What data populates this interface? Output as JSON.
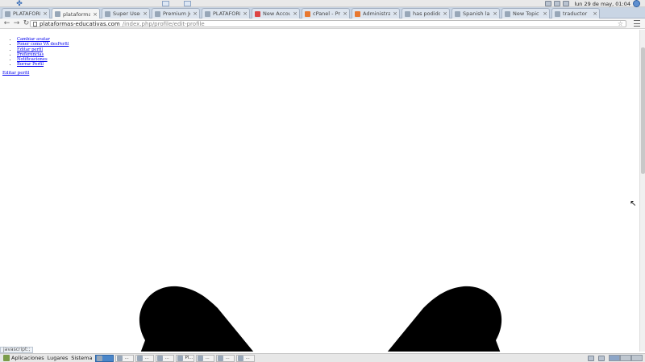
{
  "system": {
    "clock": "lun 29 de may, 01:04"
  },
  "browser": {
    "tabs": [
      {
        "label": "PLATAFORMA",
        "active": false,
        "icon": "globe-icon"
      },
      {
        "label": "plataformas",
        "active": true,
        "icon": "page-icon"
      },
      {
        "label": "Super User",
        "active": false,
        "icon": "site-icon"
      },
      {
        "label": "Premium Joo",
        "active": false,
        "icon": "joomla-icon"
      },
      {
        "label": "PLATAFORM",
        "active": false,
        "icon": "page-icon"
      },
      {
        "label": "New Accoun",
        "active": false,
        "icon": "gmail-icon"
      },
      {
        "label": "cPanel - Prin",
        "active": false,
        "icon": "cpanel-icon"
      },
      {
        "label": "Administrac",
        "active": false,
        "icon": "cpanel-icon"
      },
      {
        "label": "has podido",
        "active": false,
        "icon": "page-icon"
      },
      {
        "label": "Spanish lang",
        "active": false,
        "icon": "page-icon"
      },
      {
        "label": "New Topic",
        "active": false,
        "icon": "page-icon"
      },
      {
        "label": "traductor",
        "active": false,
        "icon": "google-icon"
      }
    ],
    "address": {
      "host": "plataformas-educativas.com",
      "path": "/index.php/profile/edit-profile"
    },
    "status_url": "javascript:;"
  },
  "page": {
    "menu_items": [
      "Cambiar avatar",
      "Poner como VA desPerfil",
      "Editar perfil",
      "Preferencias",
      "Notificaciones",
      "Borrar Perfil"
    ],
    "main_link": "Editar perfil"
  },
  "taskbar": {
    "menus": [
      "Aplicaciones",
      "Lugares",
      "Sistema"
    ],
    "tasks": [
      {
        "label": "",
        "active": true
      },
      {
        "label": "...",
        "active": false
      },
      {
        "label": "...",
        "active": false
      },
      {
        "label": "...",
        "active": false
      },
      {
        "label": "Pl...",
        "active": false
      },
      {
        "label": "...",
        "active": false
      },
      {
        "label": "...",
        "active": false
      },
      {
        "label": "...",
        "active": false
      }
    ]
  },
  "colors": {
    "link": "#0000ee",
    "tab_bg": "#dde5ef",
    "active_tab": "#f5f5f5",
    "taskbar_active": "#4a86c9"
  }
}
